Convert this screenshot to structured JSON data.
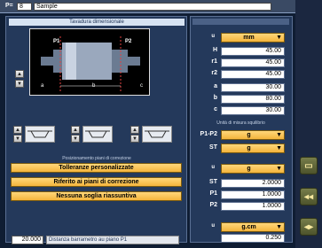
{
  "header": {
    "p_label": "P=",
    "code": "8",
    "name": "Sample"
  },
  "drawing_panel": {
    "title": "Tavadura dimensionale",
    "p1": "P1",
    "p2": "P2",
    "a": "a",
    "b": "b",
    "c": "c"
  },
  "mode_panel": {
    "title": "Posizionamento piani di correzione",
    "buttons": [
      "Tolleranze personalizzate",
      "Riferito ai piani di correzione",
      "Nessuna soglia riassuntiva"
    ]
  },
  "bottom": {
    "value": "20.000",
    "label": "Distanza barrametro au piano P1"
  },
  "dims": {
    "unit": "mm",
    "rows": [
      {
        "label": "H",
        "value": "45.00"
      },
      {
        "label": "r1",
        "value": "45.00"
      },
      {
        "label": "r2",
        "value": "45.00"
      },
      {
        "label": "a",
        "value": "30.00"
      },
      {
        "label": "b",
        "value": "80.00"
      },
      {
        "label": "c",
        "value": "30.00"
      }
    ]
  },
  "measure": {
    "title": "Unità di misura squilibrio",
    "rows": [
      {
        "label": "P1-P2",
        "value": "g"
      },
      {
        "label": "ST",
        "value": "g"
      }
    ]
  },
  "tolerance": {
    "unit": "g",
    "rows": [
      {
        "label": "ST",
        "value": "2.0000"
      },
      {
        "label": "P1",
        "value": "1.0000"
      },
      {
        "label": "P2",
        "value": "1.0000"
      }
    ]
  },
  "bottom_right": {
    "unit": "g.cm",
    "value": "0.250"
  },
  "colors": {
    "bg": "#0f1d33",
    "panel": "#24395b",
    "accent": "#f4b43b"
  }
}
